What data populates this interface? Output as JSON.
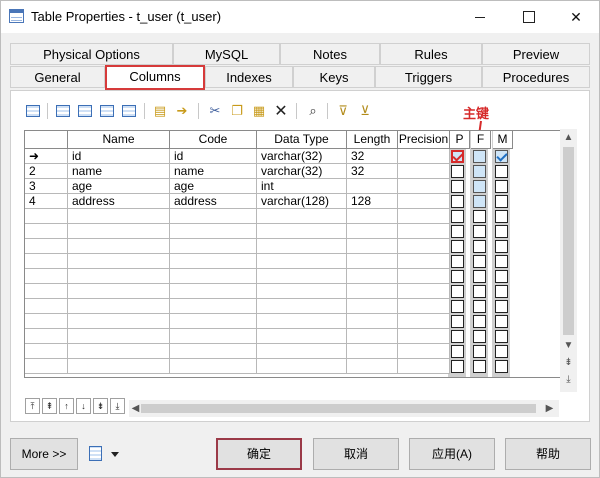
{
  "window": {
    "title": "Table Properties - t_user (t_user)"
  },
  "tabs_row1": [
    {
      "label": "Physical Options"
    },
    {
      "label": "MySQL"
    },
    {
      "label": "Notes"
    },
    {
      "label": "Rules"
    },
    {
      "label": "Preview"
    }
  ],
  "tabs_row2": [
    {
      "label": "General"
    },
    {
      "label": "Columns"
    },
    {
      "label": "Indexes"
    },
    {
      "label": "Keys"
    },
    {
      "label": "Triggers"
    },
    {
      "label": "Procedures"
    }
  ],
  "active_tab": "Columns",
  "annotation": {
    "text": "主键",
    "color": "#d62a2a"
  },
  "columns": {
    "headers": [
      "Name",
      "Code",
      "Data Type",
      "Length",
      "Precision",
      "P",
      "F",
      "M"
    ],
    "rows": [
      {
        "marker": "➜",
        "name": "id",
        "code": "id",
        "data_type": "varchar(32)",
        "length": "32",
        "precision": "",
        "p": true,
        "f": false,
        "m": true
      },
      {
        "marker": "2",
        "name": "name",
        "code": "name",
        "data_type": "varchar(32)",
        "length": "32",
        "precision": "",
        "p": false,
        "f": false,
        "m": false
      },
      {
        "marker": "3",
        "name": "age",
        "code": "age",
        "data_type": "int",
        "length": "",
        "precision": "",
        "p": false,
        "f": false,
        "m": false
      },
      {
        "marker": "4",
        "name": "address",
        "code": "address",
        "data_type": "varchar(128)",
        "length": "128",
        "precision": "",
        "p": false,
        "f": false,
        "m": false
      }
    ]
  },
  "buttons": {
    "more": "More >>",
    "ok": "确定",
    "cancel": "取消",
    "apply": "应用(A)",
    "help": "帮助"
  }
}
